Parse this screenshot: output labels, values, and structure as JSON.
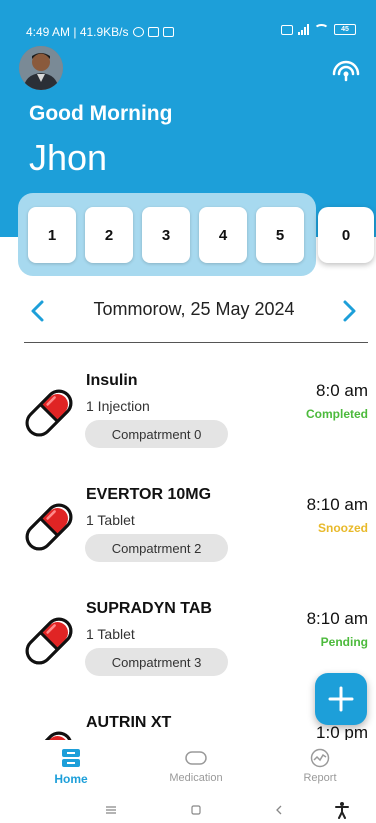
{
  "status_bar": {
    "time_speed": "4:49 AM | 41.9KB/s",
    "battery": "45"
  },
  "header": {
    "greeting": "Good Morning",
    "user_name": "Jhon"
  },
  "compartments": [
    "1",
    "2",
    "3",
    "4",
    "5"
  ],
  "compartment_extra": "0",
  "date_nav": {
    "label": "Tommorow, 25 May 2024"
  },
  "medications": [
    {
      "name": "Insulin",
      "dose": "1 Injection",
      "compartment": "Compatrment 0",
      "time": "8:0 am",
      "status": "Completed",
      "status_color": "#4cba3c"
    },
    {
      "name": "EVERTOR 10MG",
      "dose": "1 Tablet",
      "compartment": "Compatrment 2",
      "time": "8:10 am",
      "status": "Snoozed",
      "status_color": "#e8b92a"
    },
    {
      "name": "SUPRADYN TAB",
      "dose": "1 Tablet",
      "compartment": "Compatrment 3",
      "time": "8:10 am",
      "status": "Pending",
      "status_color": "#4cba3c"
    },
    {
      "name": "AUTRIN XT",
      "dose": "",
      "compartment": "",
      "time": "1:0 pm",
      "status": "",
      "status_color": "#4cba3c"
    }
  ],
  "bottom_nav": {
    "home": "Home",
    "medication": "Medication",
    "report": "Report"
  },
  "colors": {
    "primary": "#1d9fd9",
    "panel": "#a7d9ef",
    "pill_red": "#e02424"
  }
}
